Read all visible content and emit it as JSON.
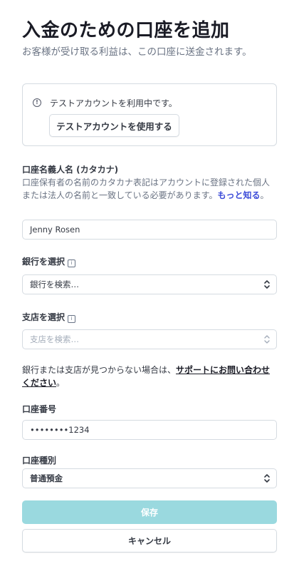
{
  "header": {
    "title": "入金のための口座を追加",
    "subtitle": "お客様が受け取る利益は、この口座に送金されます。"
  },
  "notice": {
    "message": "テストアカウントを利用中です。",
    "button_label": "テストアカウントを使用する",
    "icon": "info-circle-icon"
  },
  "account_holder": {
    "label": "口座名義人名 (カタカナ)",
    "hint": "口座保有者の名前のカタカナ表記はアカウントに登録された個人または法人の名前と一致している必要があります。",
    "hint_link": "もっと知る",
    "hint_suffix": "。",
    "value": "Jenny Rosen"
  },
  "bank": {
    "label": "銀行を選択",
    "placeholder": "銀行を検索…"
  },
  "branch": {
    "label": "支店を選択",
    "placeholder": "支店を検索…"
  },
  "support": {
    "text": "銀行または支店が見つからない場合は、",
    "link": "サポートにお問い合わせください",
    "suffix": "。"
  },
  "account_number": {
    "label": "口座番号",
    "value": "••••••••1234"
  },
  "account_type": {
    "label": "口座種別",
    "value": "普通預金"
  },
  "actions": {
    "save_label": "保存",
    "cancel_label": "キャンセル"
  },
  "colors": {
    "save_button_bg": "#9ad9df",
    "link": "#3b4bd8"
  }
}
